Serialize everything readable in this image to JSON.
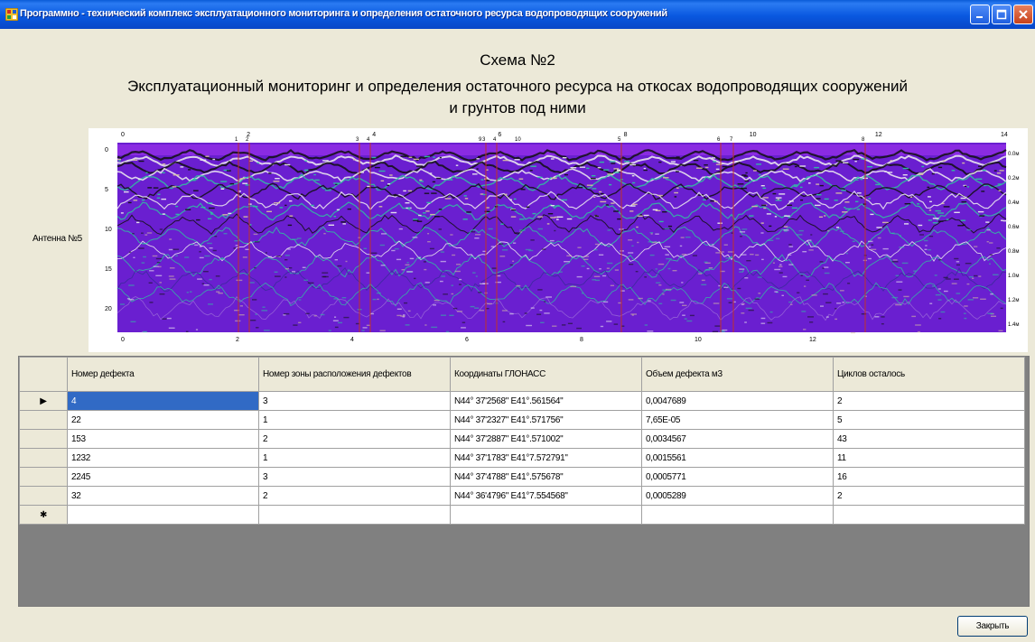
{
  "window": {
    "title": "Программно - технический комплекс эксплуатационного мониторинга и определения остаточного ресурса водопроводящих сооружений"
  },
  "header": {
    "scheme": "Схема №2",
    "line1": "Эксплуатационный мониторинг и определения остаточного ресурса на откосах водопроводящих сооружений",
    "line2": "и грунтов под ними"
  },
  "radargram": {
    "antenna_label": "Антенна №5",
    "top_tick_labels": [
      "0",
      "2",
      "4",
      "6",
      "8",
      "10",
      "12",
      "14"
    ],
    "bottom_tick_labels": [
      "0",
      "2",
      "4",
      "6",
      "8",
      "10",
      "12"
    ],
    "left_tick_labels": [
      "0",
      "5",
      "10",
      "15",
      "20"
    ],
    "right_tick_labels": [
      "0.0м",
      "0.2м",
      "0.4м",
      "0.6м",
      "0.8м",
      "1.0м",
      "1.2м",
      "1.4м"
    ],
    "marker_labels": [
      "1",
      "2",
      "3",
      "4",
      "3",
      "4",
      "5",
      "6",
      "7",
      "8",
      "9",
      "10"
    ],
    "colors": {
      "base": "#6a1fd0",
      "top_band": "#8a2be2",
      "trace_light": "#f0f0f0",
      "trace_dark": "#101010",
      "accent": "#2ec4a0",
      "marker": "#c0302a"
    }
  },
  "grid": {
    "columns": [
      "Номер дефекта",
      "Номер зоны расположения дефектов",
      "Координаты ГЛОНАСС",
      "Объем дефекта м3",
      "Циклов осталось"
    ],
    "rows": [
      [
        "4",
        "3",
        "N44° 37'2568\" E41°.561564\"",
        "0,0047689",
        "2"
      ],
      [
        "22",
        "1",
        "N44° 37'2327\" E41°.571756\"",
        "7,65Е-05",
        "5"
      ],
      [
        "153",
        "2",
        "N44° 37'2887\" E41°.571002\"",
        "0,0034567",
        "43"
      ],
      [
        "1232",
        "1",
        "N44° 37'1783\" E41°7.572791\"",
        "0,0015561",
        "11"
      ],
      [
        "2245",
        "3",
        "N44° 37'4788\" E41°.575678\"",
        "0,0005771",
        "16"
      ],
      [
        "32",
        "2",
        "N44° 36'4796\" E41°7.554568\"",
        "0,0005289",
        "2"
      ]
    ],
    "selected_row": 0,
    "current_row_marker": "▶",
    "new_row_marker": "✱"
  },
  "buttons": {
    "close": "Закрыть"
  }
}
